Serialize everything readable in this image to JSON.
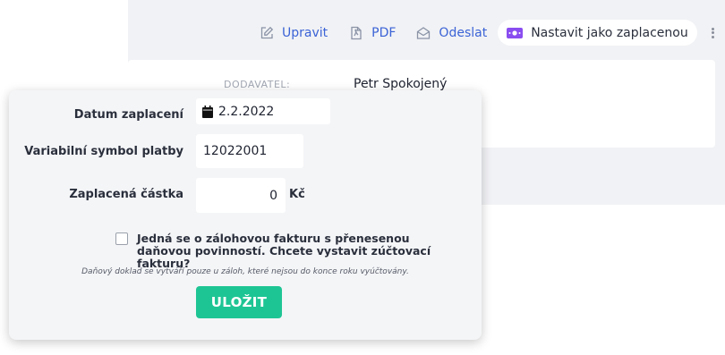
{
  "toolbar": {
    "edit_label": "Upravit",
    "pdf_label": "PDF",
    "send_label": "Odeslat",
    "mark_paid_label": "Nastavit jako zaplacenou",
    "more_icon": "more-vertical-icon"
  },
  "invoice": {
    "supplier_label": "DODAVATEL:",
    "supplier_name": "Petr Spokojený"
  },
  "modal": {
    "payment_date_label": "Datum zaplacení",
    "payment_date_value": "2.2.2022",
    "variable_symbol_label": "Variabilní symbol platby",
    "variable_symbol_value": "12022001",
    "amount_label": "Zaplacená částka",
    "amount_value": "0",
    "currency": "Kč",
    "advance_checkbox_checked": false,
    "advance_checkbox_label": "Jedná se o zálohovou fakturu s přenesenou daňovou povinností. Chcete vystavit zúčtovací fakturu?",
    "note": "Daňový doklad se vytváří pouze u záloh, které nejsou do konce roku vyúčtovány.",
    "save_label": "ULOŽIT"
  },
  "colors": {
    "link": "#3b63d6",
    "paid_icon": "#8a4df0",
    "save_button": "#1ec594",
    "page_gray": "#f1f2f5"
  }
}
